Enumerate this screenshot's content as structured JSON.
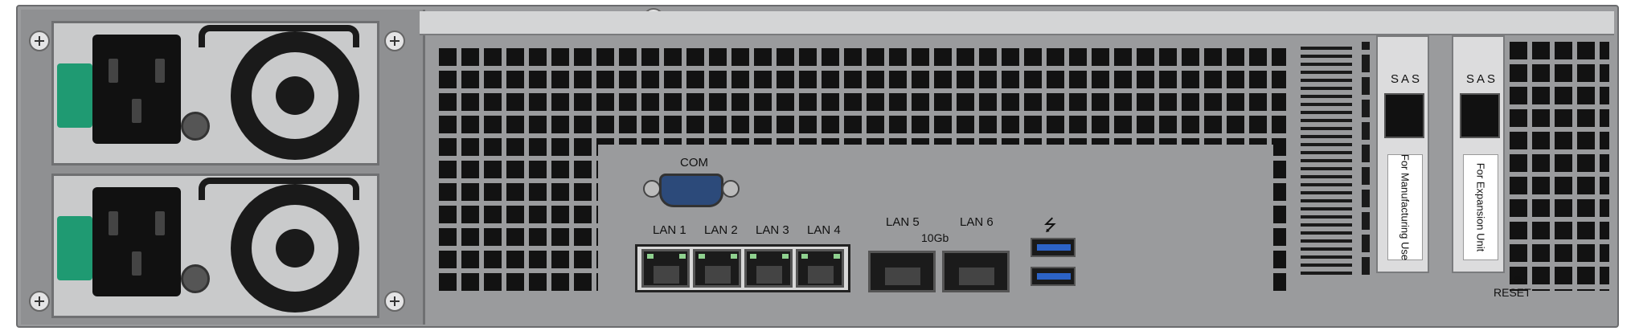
{
  "labels": {
    "com": "COM",
    "lan1": "LAN 1",
    "lan2": "LAN 2",
    "lan3": "LAN 3",
    "lan4": "LAN 4",
    "lan5": "LAN 5",
    "lan6": "LAN 6",
    "tenGb": "10Gb",
    "usb_symbol": "⭍",
    "sas1": "SAS",
    "sas2": "SAS",
    "sticker1": "For Manufacturing Use",
    "sticker2": "For Expansion Unit",
    "reset": "RESET"
  },
  "colors": {
    "chassis": "#9a9b9d",
    "psu_latch": "#1f9a72",
    "com_port": "#2c4a7a",
    "usb_blue": "#2c63c7",
    "lan_led": "#8fd18f"
  }
}
